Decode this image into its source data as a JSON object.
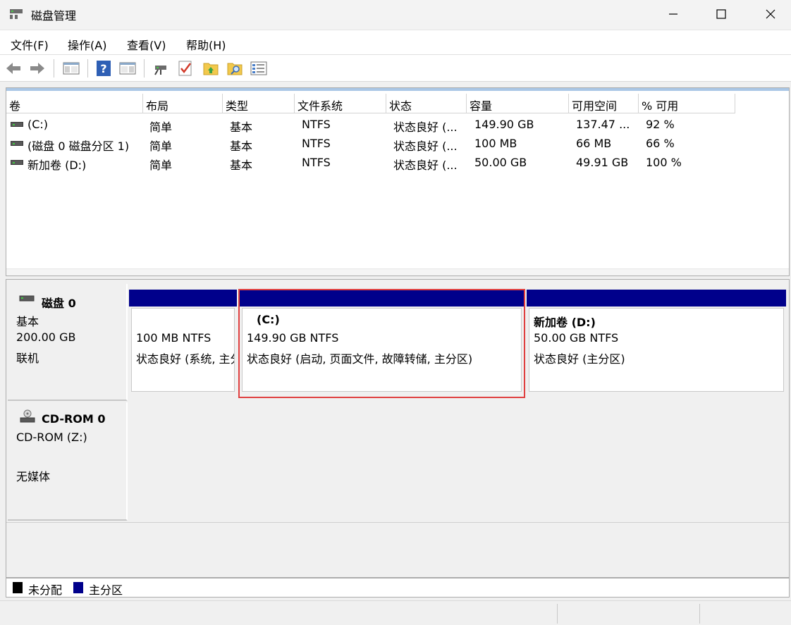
{
  "window": {
    "title": "磁盘管理"
  },
  "menu": {
    "items": [
      "文件(F)",
      "操作(A)",
      "查看(V)",
      "帮助(H)"
    ]
  },
  "toolbar": {
    "icons": [
      "back-icon",
      "forward-icon",
      "show-hide-console-tree-icon",
      "help-icon",
      "show-hide-action-pane-icon",
      "connect-disk-icon",
      "check-icon",
      "folder-up-icon",
      "search-folder-icon",
      "properties-list-icon"
    ]
  },
  "volume_list": {
    "columns": [
      "卷",
      "布局",
      "类型",
      "文件系统",
      "状态",
      "容量",
      "可用空间",
      "% 可用"
    ],
    "rows": [
      {
        "volume": "(C:)",
        "layout": "简单",
        "type": "基本",
        "fs": "NTFS",
        "status": "状态良好 (...",
        "capacity": "149.90 GB",
        "free": "137.47 ...",
        "pct": "92 %"
      },
      {
        "volume": "(磁盘 0 磁盘分区 1)",
        "layout": "简单",
        "type": "基本",
        "fs": "NTFS",
        "status": "状态良好 (...",
        "capacity": "100 MB",
        "free": "66 MB",
        "pct": "66 %"
      },
      {
        "volume": "新加卷 (D:)",
        "layout": "简单",
        "type": "基本",
        "fs": "NTFS",
        "status": "状态良好 (...",
        "capacity": "50.00 GB",
        "free": "49.91 GB",
        "pct": "100 %"
      }
    ]
  },
  "disks": [
    {
      "name": "磁盘 0",
      "type": "基本",
      "size": "200.00 GB",
      "state": "联机",
      "partitions": [
        {
          "label": "",
          "size_fs": "100 MB NTFS",
          "status": "状态良好 (系统, 主分区)"
        },
        {
          "label": "(C:)",
          "size_fs": "149.90 GB NTFS",
          "status": "状态良好 (启动, 页面文件, 故障转储, 主分区)"
        },
        {
          "label": "新加卷  (D:)",
          "size_fs": "50.00 GB NTFS",
          "status": "状态良好 (主分区)"
        }
      ]
    },
    {
      "name": "CD-ROM 0",
      "type": "CD-ROM (Z:)",
      "state": "无媒体"
    }
  ],
  "legend": [
    {
      "label": "未分配",
      "color": "#000000"
    },
    {
      "label": "主分区",
      "color": "#00008b"
    }
  ],
  "colors": {
    "primary_partition": "#00008b",
    "selection": "#e04040"
  }
}
